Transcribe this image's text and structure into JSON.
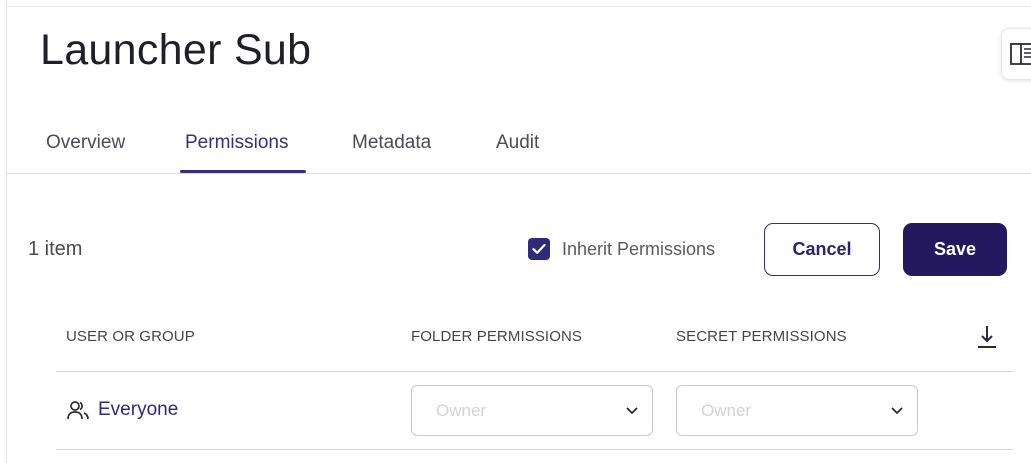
{
  "page": {
    "title": "Launcher Sub"
  },
  "tabs": [
    {
      "label": "Overview",
      "active": false
    },
    {
      "label": "Permissions",
      "active": true
    },
    {
      "label": "Metadata",
      "active": false
    },
    {
      "label": "Audit",
      "active": false
    }
  ],
  "toolbar": {
    "items_count": "1 item",
    "inherit_label": "Inherit Permissions",
    "inherit_checked": true,
    "cancel_label": "Cancel",
    "save_label": "Save"
  },
  "table": {
    "columns": [
      "USER OR GROUP",
      "FOLDER PERMISSIONS",
      "SECRET PERMISSIONS"
    ],
    "rows": [
      {
        "user": "Everyone",
        "folder_permission": "Owner",
        "secret_permission": "Owner"
      }
    ]
  },
  "icons": {
    "panel_toggle": "side-panel-icon",
    "download": "download-icon",
    "group": "group-icon",
    "dropdown": "chevron-down-icon",
    "check": "check-icon"
  },
  "colors": {
    "accent": "#24195e",
    "link": "#2f2a7a",
    "checkbox": "#2f2a7a"
  }
}
